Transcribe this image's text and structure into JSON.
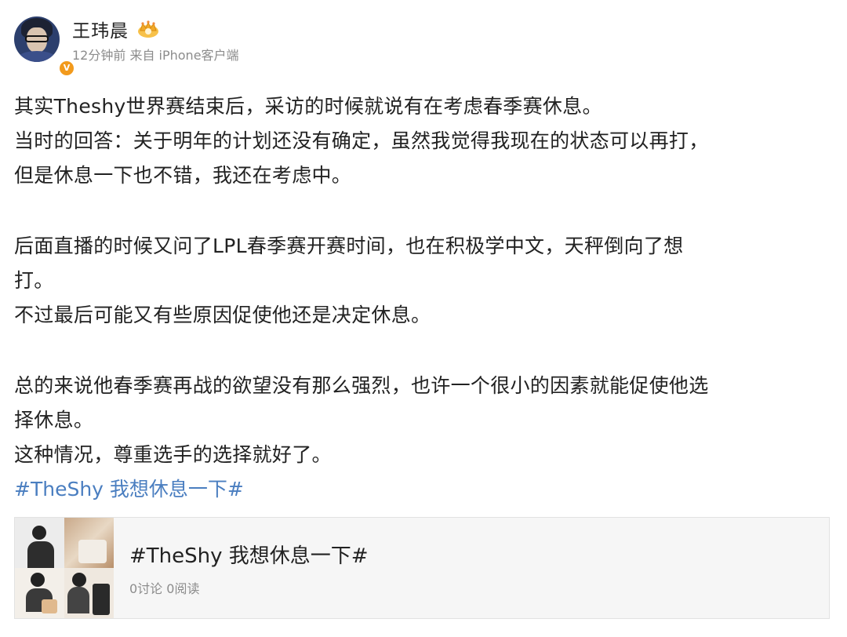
{
  "author": {
    "name": "王玮晨",
    "time_source": "12分钟前 来自 iPhone客户端",
    "verified_badge": "V"
  },
  "post": {
    "lines": [
      "其实Theshy世界赛结束后，采访的时候就说有在考虑春季赛休息。",
      "当时的回答：关于明年的计划还没有确定，虽然我觉得我现在的状态可以再打，",
      "但是休息一下也不错，我还在考虑中。",
      "后面直播的时候又问了LPL春季赛开赛时间，也在积极学中文，天秤倒向了想",
      "打。",
      "不过最后可能又有些原因促使他还是决定休息。",
      "总的来说他春季赛再战的欲望没有那么强烈，也许一个很小的因素就能促使他选",
      "择休息。",
      "这种情况，尊重选手的选择就好了。"
    ],
    "hashtag": "#TheShy 我想休息一下#"
  },
  "topic_card": {
    "title": "#TheShy 我想休息一下#",
    "stats": "0讨论 0阅读"
  },
  "colors": {
    "link": "#4a7ec0",
    "text": "#222222",
    "meta": "#8c8c8c",
    "card_bg": "#f6f6f6"
  },
  "icons": {
    "crown": "crown-icon",
    "verify": "verified-badge-icon"
  }
}
